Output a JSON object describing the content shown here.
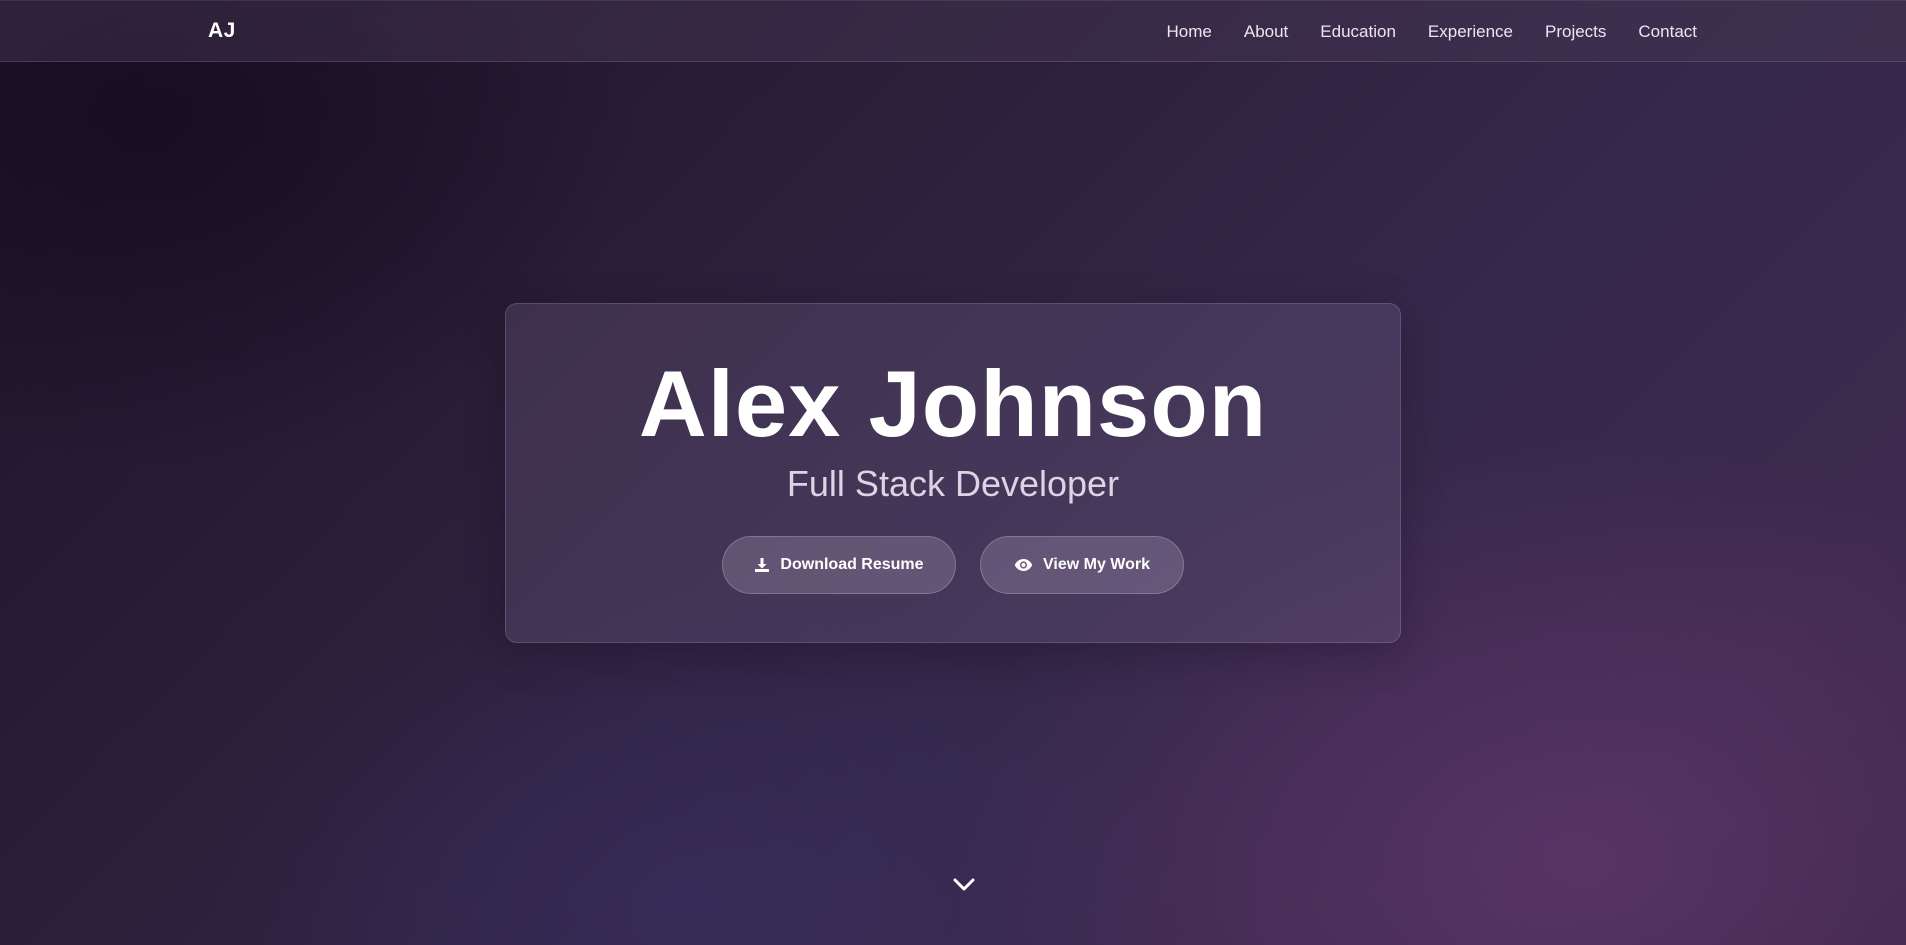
{
  "nav": {
    "logo": "AJ",
    "links": [
      "Home",
      "About",
      "Education",
      "Experience",
      "Projects",
      "Contact"
    ]
  },
  "hero": {
    "name": "Alex Johnson",
    "title": "Full Stack Developer",
    "buttons": {
      "download": {
        "label": "Download Resume",
        "icon": "download-icon"
      },
      "work": {
        "label": "View My Work",
        "icon": "eye-icon"
      }
    }
  },
  "scroll": {
    "icon": "chevron-down-icon"
  },
  "colors": {
    "background": "#2b1f3a",
    "accent": "#3e2a4e",
    "text": "#ffffff",
    "subtitle": "#dcd4e4"
  }
}
